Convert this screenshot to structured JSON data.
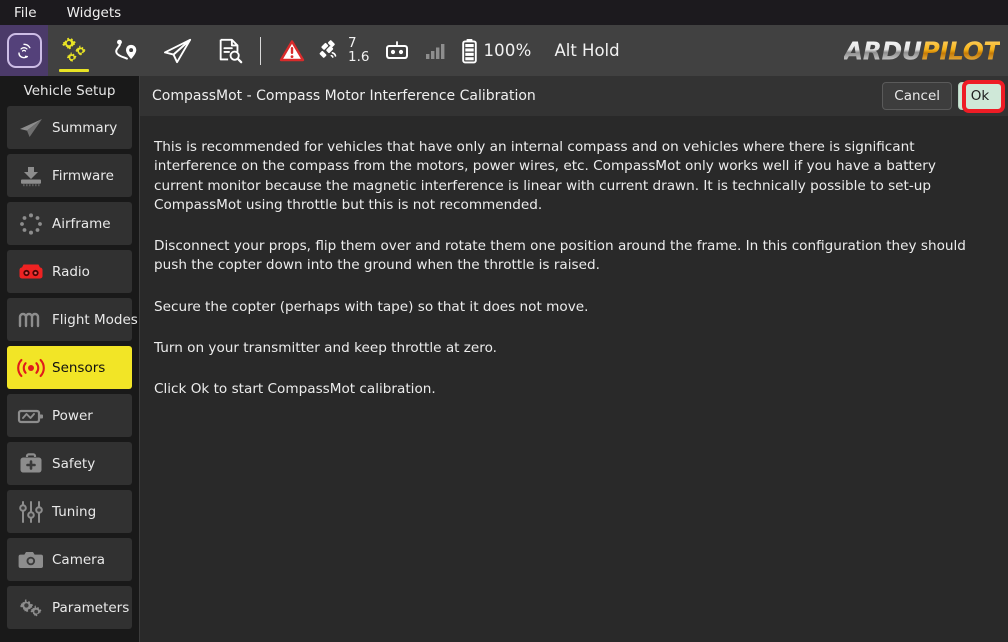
{
  "menubar": {
    "items": [
      {
        "label": "File",
        "name": "menu-file"
      },
      {
        "label": "Widgets",
        "name": "menu-widgets"
      }
    ]
  },
  "toolbar": {
    "app_button": "qgroundcontrol-logo-button",
    "icons": [
      {
        "name": "vehicle-setup-gears-icon",
        "label": "Vehicle Setup",
        "active": true
      },
      {
        "name": "plan-waypoints-icon",
        "label": "Plan",
        "active": false
      },
      {
        "name": "fly-paper-plane-icon",
        "label": "Fly",
        "active": false
      },
      {
        "name": "analyze-document-icon",
        "label": "Analyze",
        "active": false
      }
    ],
    "status": {
      "warning_icon": "warning-triangle-icon",
      "gps_icon": "gps-satellite-icon",
      "gps_satellites": "7",
      "gps_hdop": "1.6",
      "rc_icon": "rc-transmitter-icon",
      "signal_icon": "signal-bars-icon",
      "battery_icon": "battery-icon",
      "battery_percent": "100%",
      "flight_mode": "Alt Hold"
    },
    "brand": {
      "part1": "ARDU",
      "part2": "PILOT"
    }
  },
  "sidebar": {
    "title": "Vehicle Setup",
    "items": [
      {
        "label": "Summary",
        "icon": "paper-plane-icon",
        "selected": false
      },
      {
        "label": "Firmware",
        "icon": "firmware-download-icon",
        "selected": false
      },
      {
        "label": "Airframe",
        "icon": "airframe-dots-icon",
        "selected": false
      },
      {
        "label": "Radio",
        "icon": "radio-transmitter-icon",
        "selected": false
      },
      {
        "label": "Flight Modes",
        "icon": "flight-modes-waves-icon",
        "selected": false
      },
      {
        "label": "Sensors",
        "icon": "sensors-signal-icon",
        "selected": true
      },
      {
        "label": "Power",
        "icon": "power-battery-icon",
        "selected": false
      },
      {
        "label": "Safety",
        "icon": "safety-kit-icon",
        "selected": false
      },
      {
        "label": "Tuning",
        "icon": "tuning-sliders-icon",
        "selected": false
      },
      {
        "label": "Camera",
        "icon": "camera-icon",
        "selected": false
      },
      {
        "label": "Parameters",
        "icon": "parameters-gears-icon",
        "selected": false
      }
    ]
  },
  "page": {
    "title": "CompassMot - Compass Motor Interference Calibration",
    "cancel_label": "Cancel",
    "ok_label": "Ok",
    "paragraphs": [
      "This is recommended for vehicles that have only an internal compass and on vehicles where there is significant interference on the compass from the motors, power wires, etc. CompassMot only works well if you have a battery current monitor because the magnetic interference is linear with current drawn. It is technically possible to set-up CompassMot using throttle but this is not recommended.",
      "Disconnect your props, flip them over and rotate them one position around the frame. In this configuration they should push the copter down into the ground when the throttle is raised.",
      "Secure the copter (perhaps with tape) so that it does not move.",
      "Turn on your transmitter and keep throttle at zero.",
      "Click Ok to start CompassMot calibration."
    ]
  },
  "colors": {
    "toolbar_bg": "#414141",
    "content_bg": "#292929",
    "sidebar_bg": "#191919",
    "sidebar_item_bg": "#313131",
    "selected_yellow": "#f2e526",
    "annotation_red": "#ee1c25",
    "ok_button_bg": "#cfe8d8",
    "warning_red": "#d92b2b",
    "radio_red": "#ee2222",
    "brand_gold": "#f6b319"
  }
}
